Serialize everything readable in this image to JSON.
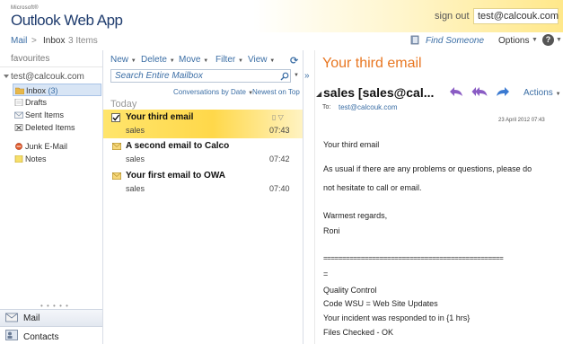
{
  "header": {
    "brand_small": "Microsoft®",
    "brand": "Outlook Web App",
    "sign_out": "sign out",
    "user": "test@calcouk.com"
  },
  "navbar": {
    "mail": "Mail",
    "separator": ">",
    "folder": "Inbox",
    "count": "3 Items",
    "find_someone": "Find Someone",
    "options": "Options",
    "help": "?"
  },
  "leftnav": {
    "favourites": "favourites",
    "account": "test@calcouk.com",
    "folders": [
      {
        "label": "Inbox",
        "count": "(3)"
      },
      {
        "label": "Drafts"
      },
      {
        "label": "Sent Items"
      },
      {
        "label": "Deleted Items"
      },
      {
        "label": "Junk E-Mail"
      },
      {
        "label": "Notes"
      }
    ],
    "grip": "• • • • •",
    "mail_tab": "Mail",
    "contacts_tab": "Contacts"
  },
  "toolbar": {
    "new": "New",
    "delete": "Delete",
    "move": "Move",
    "filter": "Filter",
    "view": "View"
  },
  "search": {
    "placeholder": "Search Entire Mailbox"
  },
  "sort": {
    "by": "Conversations by Date",
    "order": "Newest on Top"
  },
  "list": {
    "group": "Today",
    "messages": [
      {
        "subject": "Your third email",
        "from": "sales",
        "time": "07:43"
      },
      {
        "subject": "A second email to Calco",
        "from": "sales",
        "time": "07:42"
      },
      {
        "subject": "Your first email to OWA",
        "from": "sales",
        "time": "07:40"
      }
    ]
  },
  "reading": {
    "title": "Your third email",
    "from": "sales [sales@cal...",
    "actions": "Actions",
    "to_label": "To:",
    "to": "test@calcouk.com",
    "date": "23 April 2012 07:43",
    "body": [
      "Your third email",
      "As usual if there are any problems or questions, please do",
      "not hesitate to call or email.",
      "Warmest regards,",
      "Roni",
      "================================================",
      "=",
      "Quality Control",
      "Code WSU = Web Site Updates",
      "Your incident was responded to in {1 hrs}",
      "Files Checked - OK"
    ]
  },
  "colors": {
    "accent": "#e87722",
    "link": "#3b6ea5",
    "selection": "#ffd84a"
  }
}
